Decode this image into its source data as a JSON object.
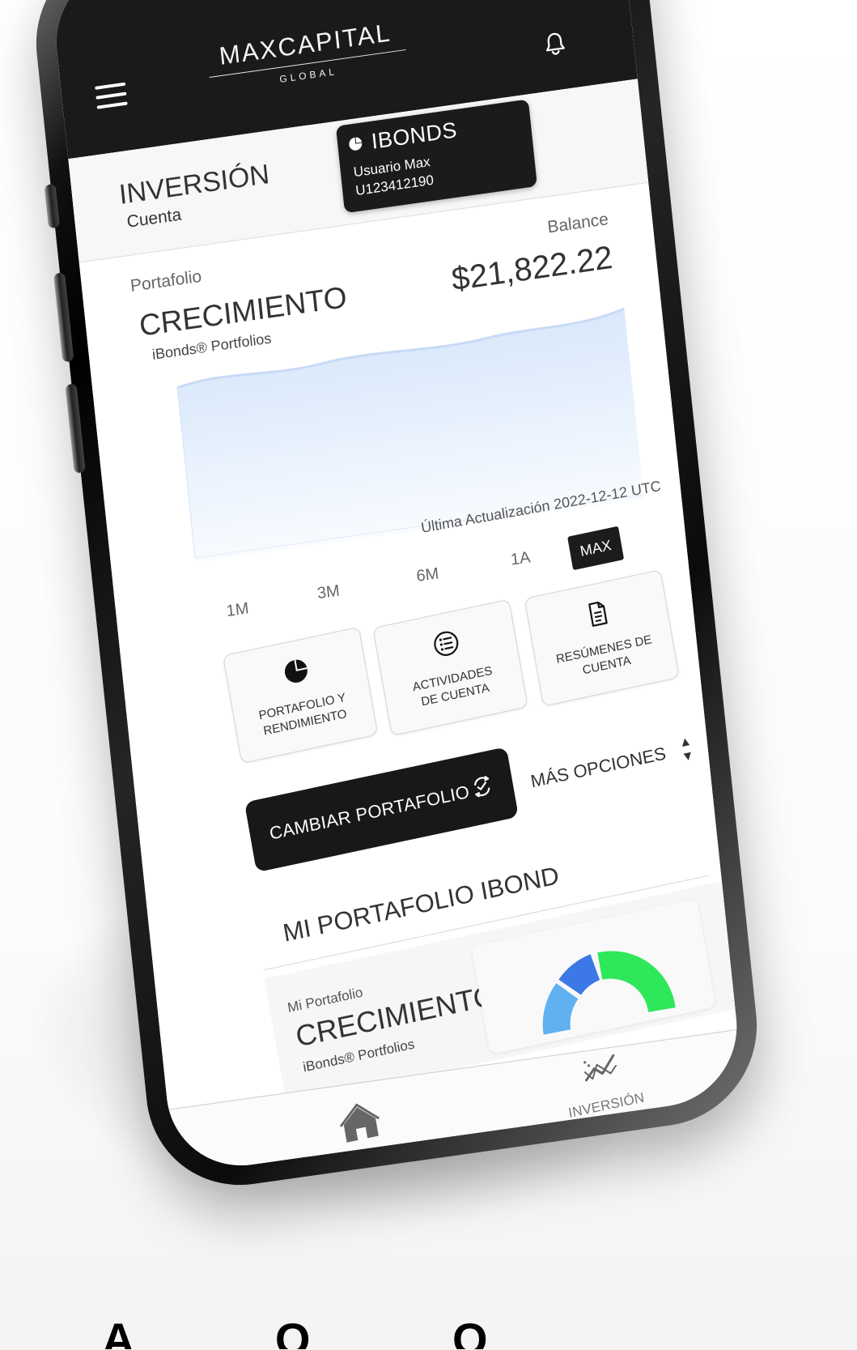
{
  "app": {
    "brand_main": "MAXCAPITAL",
    "brand_sub": "GLOBAL"
  },
  "header": {
    "title": "INVERSIÓN",
    "subtitle": "Cuenta",
    "card": {
      "title": "IBONDS",
      "user": "Usuario Max",
      "id": "U123412190"
    }
  },
  "portfolio": {
    "label": "Portafolio",
    "name": "CRECIMIENTO",
    "subtitle": "iBonds® Portfolios",
    "balance_label": "Balance",
    "balance_value": "$21,822.22",
    "updated": "Última Actualización 2022-12-12 UTC"
  },
  "ranges": [
    "1M",
    "3M",
    "6M",
    "1A",
    "MAX"
  ],
  "quick_actions": [
    {
      "label_1": "PORTAFOLIO Y",
      "label_2": "RENDIMIENTO",
      "icon": "pie-chart-icon"
    },
    {
      "label_1": "ACTIVIDADES",
      "label_2": "DE CUENTA",
      "icon": "list-icon"
    },
    {
      "label_1": "RESÚMENES DE",
      "label_2": "CUENTA",
      "icon": "document-icon"
    }
  ],
  "actions": {
    "change_portfolio": "CAMBIAR PORTAFOLIO",
    "more_options": "MÁS OPCIONES"
  },
  "section": {
    "title": "MI PORTAFOLIO IBOND"
  },
  "summary": {
    "label": "Mi Portafolio",
    "name": "CRECIMIENTO",
    "subtitle": "iBonds® Portfolios"
  },
  "bottom_nav": {
    "home": "INICIO",
    "invest": "INVERSIÓN"
  },
  "bottom_text": "A O OO",
  "colors": {
    "dark": "#1a1a1a",
    "chart_fill": "#eaf2ff",
    "gauge_light_blue": "#61b0f0",
    "gauge_blue": "#3c78e6",
    "gauge_green": "#2ee85a"
  }
}
